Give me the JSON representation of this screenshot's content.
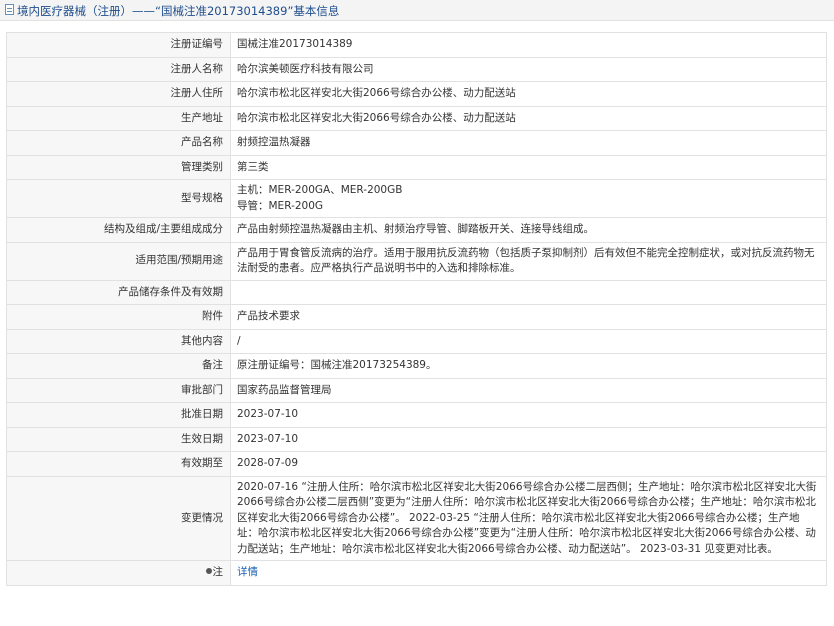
{
  "header": {
    "title": "境内医疗器械（注册）——“国械注准20173014389”基本信息"
  },
  "rows": {
    "reg_no": {
      "label": "注册证编号",
      "value": "国械注准20173014389"
    },
    "registrant": {
      "label": "注册人名称",
      "value": "哈尔滨美顿医疗科技有限公司"
    },
    "registrant_addr": {
      "label": "注册人住所",
      "value": "哈尔滨市松北区祥安北大街2066号综合办公楼、动力配送站"
    },
    "prod_addr": {
      "label": "生产地址",
      "value": "哈尔滨市松北区祥安北大街2066号综合办公楼、动力配送站"
    },
    "product_name": {
      "label": "产品名称",
      "value": "射频控温热凝器"
    },
    "mgmt_class": {
      "label": "管理类别",
      "value": "第三类"
    },
    "model": {
      "label": "型号规格",
      "line1": "主机：MER-200GA、MER-200GB",
      "line2": "导管：MER-200G"
    },
    "structure": {
      "label": "结构及组成/主要组成成分",
      "value": "产品由射频控温热凝器由主机、射频治疗导管、脚踏板开关、连接导线组成。"
    },
    "scope": {
      "label": "适用范围/预期用途",
      "value": "产品用于胃食管反流病的治疗。适用于服用抗反流药物（包括质子泵抑制剂）后有效但不能完全控制症状，或对抗反流药物无法耐受的患者。应严格执行产品说明书中的入选和排除标准。"
    },
    "storage": {
      "label": "产品储存条件及有效期",
      "value": ""
    },
    "attachment": {
      "label": "附件",
      "value": "产品技术要求"
    },
    "other": {
      "label": "其他内容",
      "value": "/"
    },
    "remark": {
      "label": "备注",
      "value": "原注册证编号：国械注准20173254389。"
    },
    "approval_dept": {
      "label": "审批部门",
      "value": "国家药品监督管理局"
    },
    "approval_date": {
      "label": "批准日期",
      "value": "2023-07-10"
    },
    "effective_date": {
      "label": "生效日期",
      "value": "2023-07-10"
    },
    "expiry": {
      "label": "有效期至",
      "value": "2028-07-09"
    },
    "changes": {
      "label": "变更情况",
      "value": "2020-07-16 “注册人住所：哈尔滨市松北区祥安北大街2066号综合办公楼二层西侧；生产地址：哈尔滨市松北区祥安北大街2066号综合办公楼二层西侧”变更为“注册人住所：哈尔滨市松北区祥安北大街2066号综合办公楼；生产地址：哈尔滨市松北区祥安北大街2066号综合办公楼”。 2022-03-25 “注册人住所：哈尔滨市松北区祥安北大街2066号综合办公楼；生产地址：哈尔滨市松北区祥安北大街2066号综合办公楼”变更为“注册人住所：哈尔滨市松北区祥安北大街2066号综合办公楼、动力配送站；生产地址：哈尔滨市松北区祥安北大街2066号综合办公楼、动力配送站”。 2023-03-31 见变更对比表。"
    },
    "note": {
      "label": "注",
      "icon": "pin-icon",
      "link": "详情"
    }
  },
  "colors": {
    "header_title": "#1f4e8c",
    "label_bg": "#f7f7f7",
    "border": "#e1e1e1",
    "link": "#1a5fb4"
  }
}
